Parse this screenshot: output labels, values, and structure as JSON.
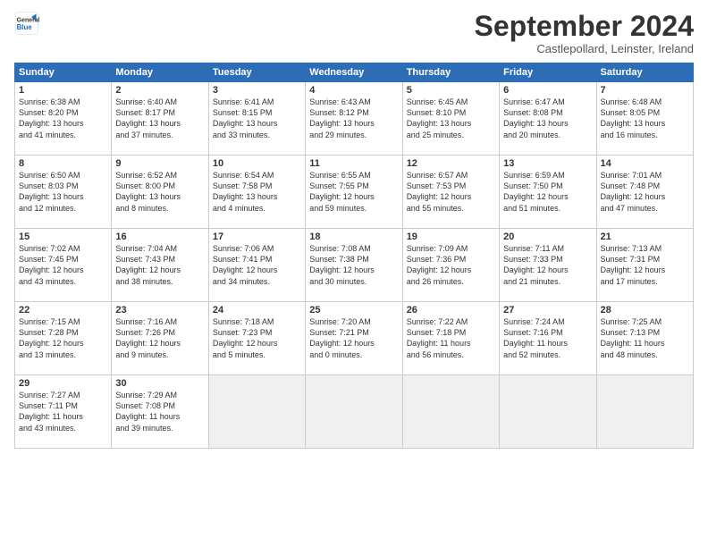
{
  "header": {
    "logo_general": "General",
    "logo_blue": "Blue",
    "month_title": "September 2024",
    "subtitle": "Castlepollard, Leinster, Ireland"
  },
  "weekdays": [
    "Sunday",
    "Monday",
    "Tuesday",
    "Wednesday",
    "Thursday",
    "Friday",
    "Saturday"
  ],
  "weeks": [
    [
      {
        "day": "1",
        "info": "Sunrise: 6:38 AM\nSunset: 8:20 PM\nDaylight: 13 hours\nand 41 minutes."
      },
      {
        "day": "2",
        "info": "Sunrise: 6:40 AM\nSunset: 8:17 PM\nDaylight: 13 hours\nand 37 minutes."
      },
      {
        "day": "3",
        "info": "Sunrise: 6:41 AM\nSunset: 8:15 PM\nDaylight: 13 hours\nand 33 minutes."
      },
      {
        "day": "4",
        "info": "Sunrise: 6:43 AM\nSunset: 8:12 PM\nDaylight: 13 hours\nand 29 minutes."
      },
      {
        "day": "5",
        "info": "Sunrise: 6:45 AM\nSunset: 8:10 PM\nDaylight: 13 hours\nand 25 minutes."
      },
      {
        "day": "6",
        "info": "Sunrise: 6:47 AM\nSunset: 8:08 PM\nDaylight: 13 hours\nand 20 minutes."
      },
      {
        "day": "7",
        "info": "Sunrise: 6:48 AM\nSunset: 8:05 PM\nDaylight: 13 hours\nand 16 minutes."
      }
    ],
    [
      {
        "day": "8",
        "info": "Sunrise: 6:50 AM\nSunset: 8:03 PM\nDaylight: 13 hours\nand 12 minutes."
      },
      {
        "day": "9",
        "info": "Sunrise: 6:52 AM\nSunset: 8:00 PM\nDaylight: 13 hours\nand 8 minutes."
      },
      {
        "day": "10",
        "info": "Sunrise: 6:54 AM\nSunset: 7:58 PM\nDaylight: 13 hours\nand 4 minutes."
      },
      {
        "day": "11",
        "info": "Sunrise: 6:55 AM\nSunset: 7:55 PM\nDaylight: 12 hours\nand 59 minutes."
      },
      {
        "day": "12",
        "info": "Sunrise: 6:57 AM\nSunset: 7:53 PM\nDaylight: 12 hours\nand 55 minutes."
      },
      {
        "day": "13",
        "info": "Sunrise: 6:59 AM\nSunset: 7:50 PM\nDaylight: 12 hours\nand 51 minutes."
      },
      {
        "day": "14",
        "info": "Sunrise: 7:01 AM\nSunset: 7:48 PM\nDaylight: 12 hours\nand 47 minutes."
      }
    ],
    [
      {
        "day": "15",
        "info": "Sunrise: 7:02 AM\nSunset: 7:45 PM\nDaylight: 12 hours\nand 43 minutes."
      },
      {
        "day": "16",
        "info": "Sunrise: 7:04 AM\nSunset: 7:43 PM\nDaylight: 12 hours\nand 38 minutes."
      },
      {
        "day": "17",
        "info": "Sunrise: 7:06 AM\nSunset: 7:41 PM\nDaylight: 12 hours\nand 34 minutes."
      },
      {
        "day": "18",
        "info": "Sunrise: 7:08 AM\nSunset: 7:38 PM\nDaylight: 12 hours\nand 30 minutes."
      },
      {
        "day": "19",
        "info": "Sunrise: 7:09 AM\nSunset: 7:36 PM\nDaylight: 12 hours\nand 26 minutes."
      },
      {
        "day": "20",
        "info": "Sunrise: 7:11 AM\nSunset: 7:33 PM\nDaylight: 12 hours\nand 21 minutes."
      },
      {
        "day": "21",
        "info": "Sunrise: 7:13 AM\nSunset: 7:31 PM\nDaylight: 12 hours\nand 17 minutes."
      }
    ],
    [
      {
        "day": "22",
        "info": "Sunrise: 7:15 AM\nSunset: 7:28 PM\nDaylight: 12 hours\nand 13 minutes."
      },
      {
        "day": "23",
        "info": "Sunrise: 7:16 AM\nSunset: 7:26 PM\nDaylight: 12 hours\nand 9 minutes."
      },
      {
        "day": "24",
        "info": "Sunrise: 7:18 AM\nSunset: 7:23 PM\nDaylight: 12 hours\nand 5 minutes."
      },
      {
        "day": "25",
        "info": "Sunrise: 7:20 AM\nSunset: 7:21 PM\nDaylight: 12 hours\nand 0 minutes."
      },
      {
        "day": "26",
        "info": "Sunrise: 7:22 AM\nSunset: 7:18 PM\nDaylight: 11 hours\nand 56 minutes."
      },
      {
        "day": "27",
        "info": "Sunrise: 7:24 AM\nSunset: 7:16 PM\nDaylight: 11 hours\nand 52 minutes."
      },
      {
        "day": "28",
        "info": "Sunrise: 7:25 AM\nSunset: 7:13 PM\nDaylight: 11 hours\nand 48 minutes."
      }
    ],
    [
      {
        "day": "29",
        "info": "Sunrise: 7:27 AM\nSunset: 7:11 PM\nDaylight: 11 hours\nand 43 minutes."
      },
      {
        "day": "30",
        "info": "Sunrise: 7:29 AM\nSunset: 7:08 PM\nDaylight: 11 hours\nand 39 minutes."
      },
      {
        "day": "",
        "info": ""
      },
      {
        "day": "",
        "info": ""
      },
      {
        "day": "",
        "info": ""
      },
      {
        "day": "",
        "info": ""
      },
      {
        "day": "",
        "info": ""
      }
    ]
  ]
}
